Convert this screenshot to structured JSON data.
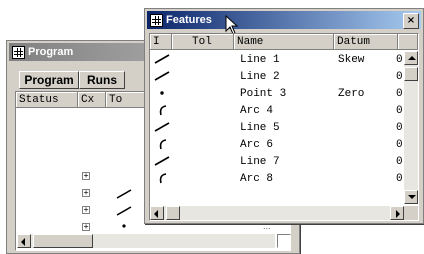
{
  "program_window": {
    "title": "Program",
    "tabs": [
      "Program",
      "Runs"
    ],
    "columns": [
      "Status",
      "Cx",
      "To"
    ],
    "partial_text": "..."
  },
  "features_window": {
    "title": "Features",
    "close_glyph": "×",
    "columns": [
      "I",
      "Tol",
      "Name",
      "Datum",
      ""
    ],
    "rows": [
      {
        "icon": "line-feature-icon",
        "name": "Line 1",
        "datum": "Skew",
        "value": "0"
      },
      {
        "icon": "line-feature-icon",
        "name": "Line 2",
        "datum": "",
        "value": "0"
      },
      {
        "icon": "point-feature-icon",
        "name": "Point 3",
        "datum": "Zero",
        "value": "0"
      },
      {
        "icon": "arc-feature-icon",
        "name": "Arc 4",
        "datum": "",
        "value": "0"
      },
      {
        "icon": "line-feature-icon",
        "name": "Line 5",
        "datum": "",
        "value": "0"
      },
      {
        "icon": "arc-feature-icon",
        "name": "Arc 6",
        "datum": "",
        "value": "0"
      },
      {
        "icon": "line-feature-icon",
        "name": "Line 7",
        "datum": "",
        "value": "0"
      },
      {
        "icon": "arc-feature-icon",
        "name": "Arc 8",
        "datum": "",
        "value": "0"
      }
    ]
  },
  "colors": {
    "active_title": "#0a246a",
    "inactive_title": "#808080",
    "face": "#d4d0c8",
    "list_bg": "#ffffff"
  }
}
